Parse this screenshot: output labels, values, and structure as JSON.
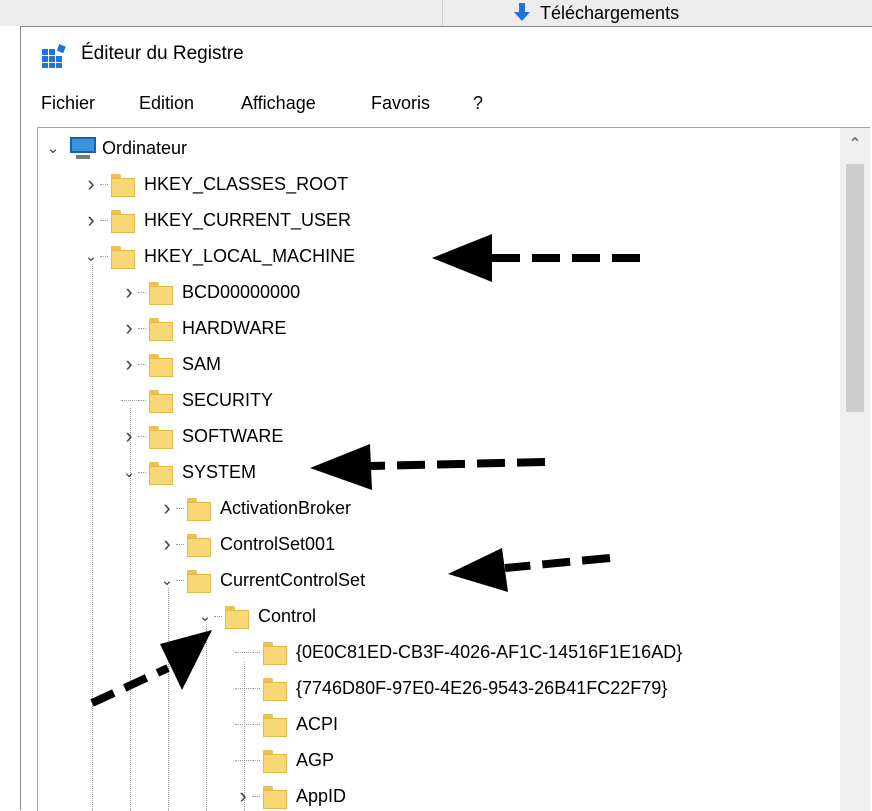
{
  "background_window": {
    "downloads_label": "Téléchargements"
  },
  "window": {
    "title": "Éditeur du Registre"
  },
  "menu": [
    "Fichier",
    "Edition",
    "Affichage",
    "Favoris",
    "?"
  ],
  "tree": {
    "root": "Ordinateur",
    "nodes": [
      {
        "label": "HKEY_CLASSES_ROOT",
        "state": "collapsed",
        "level": 1
      },
      {
        "label": "HKEY_CURRENT_USER",
        "state": "collapsed",
        "level": 1
      },
      {
        "label": "HKEY_LOCAL_MACHINE",
        "state": "expanded",
        "level": 1
      },
      {
        "label": "BCD00000000",
        "state": "collapsed",
        "level": 2
      },
      {
        "label": "HARDWARE",
        "state": "collapsed",
        "level": 2
      },
      {
        "label": "SAM",
        "state": "collapsed",
        "level": 2
      },
      {
        "label": "SECURITY",
        "state": "leaf",
        "level": 2
      },
      {
        "label": "SOFTWARE",
        "state": "collapsed",
        "level": 2
      },
      {
        "label": "SYSTEM",
        "state": "expanded",
        "level": 2
      },
      {
        "label": "ActivationBroker",
        "state": "collapsed",
        "level": 3
      },
      {
        "label": "ControlSet001",
        "state": "collapsed",
        "level": 3
      },
      {
        "label": "CurrentControlSet",
        "state": "expanded",
        "level": 3
      },
      {
        "label": "Control",
        "state": "expanded",
        "level": 4
      },
      {
        "label": "{0E0C81ED-CB3F-4026-AF1C-14516F1E16AD}",
        "state": "leaf",
        "level": 5
      },
      {
        "label": "{7746D80F-97E0-4E26-9543-26B41FC22F79}",
        "state": "leaf",
        "level": 5
      },
      {
        "label": "ACPI",
        "state": "leaf",
        "level": 5
      },
      {
        "label": "AGP",
        "state": "leaf",
        "level": 5
      },
      {
        "label": "AppID",
        "state": "collapsed",
        "level": 5
      }
    ]
  },
  "icons": {
    "app": "registry-editor-icon",
    "root": "computer-icon",
    "node": "folder-icon",
    "downloads": "download-arrow-icon"
  },
  "colors": {
    "folder": "#f8d775",
    "arrow": "#000000",
    "computer": "#3b93e0"
  }
}
